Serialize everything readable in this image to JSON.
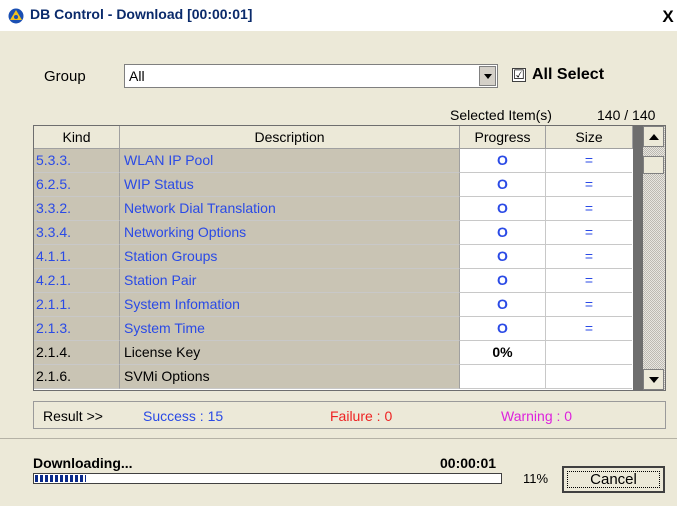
{
  "window": {
    "title": "DB Control - Download [00:00:01]",
    "close_label": "X"
  },
  "filter": {
    "group_label": "Group",
    "group_value": "All",
    "all_select_checked": "☑",
    "all_select_label": "All Select"
  },
  "selection": {
    "label": "Selected Item(s)",
    "count": "140 / 140"
  },
  "table": {
    "headers": {
      "kind": "Kind",
      "description": "Description",
      "progress": "Progress",
      "size": "Size"
    },
    "rows": [
      {
        "kind": "5.3.3.",
        "description": "WLAN IP Pool",
        "progress": "O",
        "size": "=",
        "status": "done"
      },
      {
        "kind": "6.2.5.",
        "description": "WIP Status",
        "progress": "O",
        "size": "=",
        "status": "done"
      },
      {
        "kind": "3.3.2.",
        "description": "Network Dial Translation",
        "progress": "O",
        "size": "=",
        "status": "done"
      },
      {
        "kind": "3.3.4.",
        "description": "Networking Options",
        "progress": "O",
        "size": "=",
        "status": "done"
      },
      {
        "kind": "4.1.1.",
        "description": "Station Groups",
        "progress": "O",
        "size": "=",
        "status": "done"
      },
      {
        "kind": "4.2.1.",
        "description": "Station Pair",
        "progress": "O",
        "size": "=",
        "status": "done"
      },
      {
        "kind": "2.1.1.",
        "description": "System Infomation",
        "progress": "O",
        "size": "=",
        "status": "done"
      },
      {
        "kind": "2.1.3.",
        "description": "System Time",
        "progress": "O",
        "size": "=",
        "status": "done"
      },
      {
        "kind": "2.1.4.",
        "description": "License Key",
        "progress": "0%",
        "size": "",
        "status": "active"
      },
      {
        "kind": "2.1.6.",
        "description": "SVMi Options",
        "progress": "",
        "size": "",
        "status": "pending"
      }
    ]
  },
  "result": {
    "label": "Result >>",
    "success": "Success : 15",
    "failure": "Failure : 0",
    "warning": "Warning : 0"
  },
  "download": {
    "status": "Downloading...",
    "elapsed": "00:00:01",
    "percent_label": "11%",
    "percent_value": 0.11,
    "cancel_label": "Cancel"
  },
  "colors": {
    "done_text": "#2a4ae6",
    "success": "#2a4ae6",
    "failure": "#ee2222",
    "warning": "#dd22dd"
  }
}
